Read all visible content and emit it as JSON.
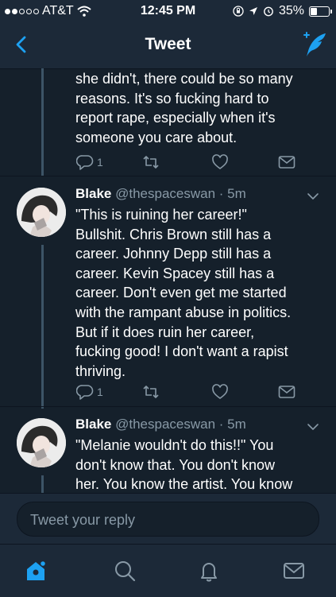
{
  "status_bar": {
    "carrier": "AT&T",
    "time": "12:45 PM",
    "battery_percent": "35%",
    "battery_level": 0.35
  },
  "header": {
    "title": "Tweet"
  },
  "tweets": [
    {
      "text_lines": [
        "she didn't, there could be so many",
        "reasons. It's so fucking hard to",
        "report rape, especially when it's",
        "someone you care about."
      ],
      "reply_count": "1"
    },
    {
      "name": "Blake",
      "handle": "@thespaceswan",
      "time": "· 5m",
      "text_lines": [
        "\"This is ruining her career!\"",
        "Bullshit. Chris Brown still has a",
        "career. Johnny Depp still has a",
        "career. Kevin Spacey still has a",
        "career. Don't even get me started",
        "with the rampant abuse in politics.",
        "But if it does ruin her career,",
        "fucking good! I don't want a rapist",
        "thriving."
      ],
      "reply_count": "1"
    },
    {
      "name": "Blake",
      "handle": "@thespaceswan",
      "time": "· 5m",
      "text_lines": [
        "\"Melanie wouldn't do this!!\" You",
        "don't know that. You don't know",
        "her. You know the artist. You know"
      ]
    }
  ],
  "reply": {
    "placeholder": "Tweet your reply"
  },
  "tabs": [
    "home-icon",
    "search-icon",
    "notifications-icon",
    "messages-icon"
  ],
  "colors": {
    "background": "#15202b",
    "bar": "#1c2938",
    "accent": "#1da1f2",
    "muted": "#8899a6"
  }
}
